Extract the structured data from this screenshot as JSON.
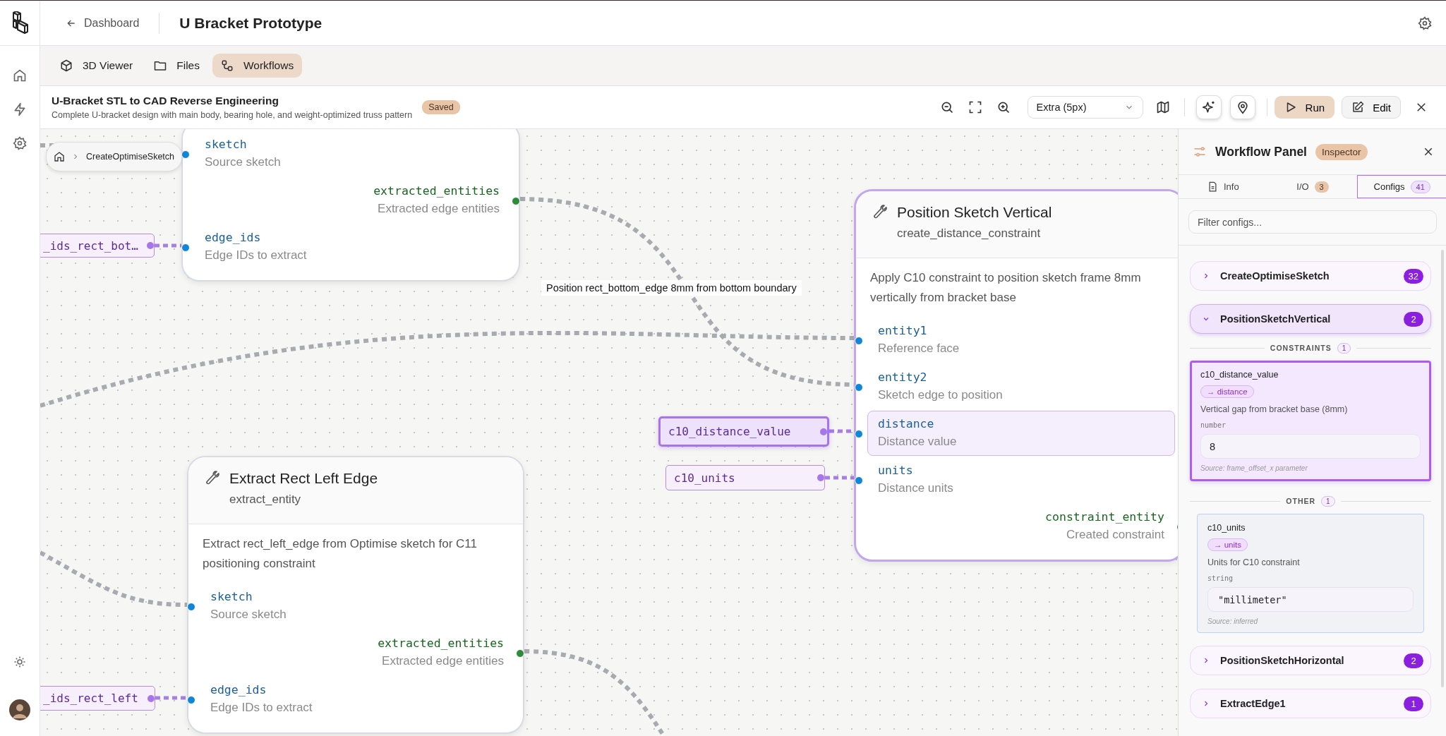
{
  "header": {
    "back_label": "Dashboard",
    "title": "U Bracket Prototype"
  },
  "tabs": [
    {
      "kind": "viewer",
      "label": "3D Viewer",
      "selected": false
    },
    {
      "kind": "files",
      "label": "Files",
      "selected": false
    },
    {
      "kind": "workflows",
      "label": "Workflows",
      "selected": true
    }
  ],
  "workflow": {
    "title": "U-Bracket STL to CAD Reverse Engineering",
    "description": "Complete U-bracket design with main body, bearing hole, and weight-optimized truss pattern",
    "status": "Saved",
    "edge_style": "Extra (5px)",
    "run_label": "Run",
    "edit_label": "Edit"
  },
  "canvas": {
    "breadcrumb": "CreateOptimiseSketch",
    "nodes": [
      {
        "selected": false,
        "ports": [
          {
            "kind": "input",
            "name": "sketch",
            "description": "Source sketch",
            "highlighted": false
          },
          {
            "kind": "output",
            "name": "extracted_entities",
            "description": "Extracted edge entities",
            "highlighted": false
          },
          {
            "kind": "input",
            "name": "edge_ids",
            "description": "Edge IDs to extract",
            "highlighted": false
          }
        ]
      },
      {
        "title": "Position Sketch Vertical",
        "subtitle": "create_distance_constraint",
        "description": "Apply C10 constraint to position sketch frame 8mm vertically from bracket base",
        "selected": true,
        "ports": [
          {
            "kind": "input",
            "name": "entity1",
            "description": "Reference face",
            "highlighted": false
          },
          {
            "kind": "input",
            "name": "entity2",
            "description": "Sketch edge to position",
            "highlighted": false
          },
          {
            "kind": "input",
            "name": "distance",
            "description": "Distance value",
            "highlighted": true
          },
          {
            "kind": "input",
            "name": "units",
            "description": "Distance units",
            "highlighted": false
          },
          {
            "kind": "output",
            "name": "constraint_entity",
            "description": "Created constraint",
            "highlighted": false
          }
        ]
      },
      {
        "title": "Extract Rect Left Edge",
        "subtitle": "extract_entity",
        "description": "Extract rect_left_edge from Optimise sketch for C11 positioning constraint",
        "selected": false,
        "ports": [
          {
            "kind": "input",
            "name": "sketch",
            "description": "Source sketch",
            "highlighted": false
          },
          {
            "kind": "output",
            "name": "extracted_entities",
            "description": "Extracted edge entities",
            "highlighted": false
          },
          {
            "kind": "input",
            "name": "edge_ids",
            "description": "Edge IDs to extract",
            "highlighted": false
          }
        ]
      }
    ],
    "params": [
      {
        "label": "_ids_rect_bot…",
        "selected": false
      },
      {
        "label": "c10_distance_value",
        "selected": true
      },
      {
        "label": "c10_units",
        "selected": false
      },
      {
        "label": "_ids_rect_left",
        "selected": false
      }
    ],
    "edge_labels": [
      "Position rect_bottom_edge 8mm from bottom boundary"
    ]
  },
  "panel": {
    "title": "Workflow Panel",
    "badge": "Inspector",
    "tabs": [
      {
        "kind": "info",
        "label": "Info",
        "selected": false
      },
      {
        "kind": "io",
        "label": "I/O",
        "count": "3",
        "selected": false
      },
      {
        "kind": "configs",
        "label": "Configs",
        "count": "41",
        "selected": true
      }
    ],
    "filter_placeholder": "Filter configs...",
    "groups": [
      {
        "name": "CreateOptimiseSketch",
        "count": "32",
        "expanded": false
      },
      {
        "name": "PositionSketchVertical",
        "count": "2",
        "expanded": true,
        "sections": [
          {
            "label": "CONSTRAINTS",
            "count": "1",
            "configs": [
              {
                "name": "c10_distance_value",
                "target": "→ distance",
                "description": "Vertical gap from bracket base (8mm)",
                "type": "number",
                "kind": "number",
                "value": "8",
                "source": "Source: frame_offset_x parameter",
                "selected": true
              }
            ]
          },
          {
            "label": "OTHER",
            "count": "1",
            "configs": [
              {
                "name": "c10_units",
                "target": "→ units",
                "description": "Units for C10 constraint",
                "type": "string",
                "kind": "text",
                "value": "\"millimeter\"",
                "source": "Source: inferred",
                "selected": false
              }
            ]
          }
        ]
      },
      {
        "name": "PositionSketchHorizontal",
        "count": "2",
        "expanded": false
      },
      {
        "name": "ExtractEdge1",
        "count": "1",
        "expanded": false
      }
    ]
  }
}
